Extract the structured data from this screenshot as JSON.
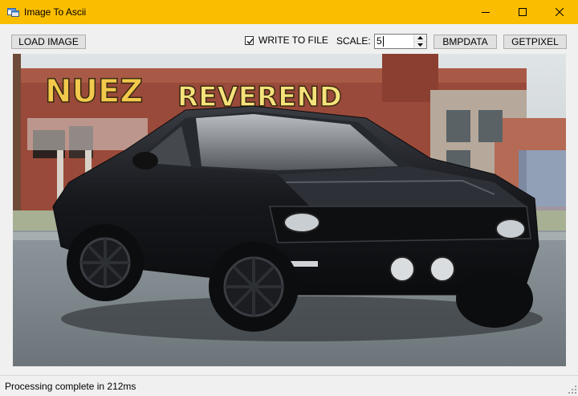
{
  "window": {
    "title": "Image To Ascii",
    "icons": {
      "app": "app-window-icon",
      "minimize": "minimize-icon",
      "maximize": "maximize-icon",
      "close": "close-icon"
    }
  },
  "toolbar": {
    "load_label": "LOAD IMAGE",
    "write_to_file_label": "WRITE TO FILE",
    "write_to_file_checked": true,
    "scale_label": "SCALE:",
    "scale_value": "5",
    "bmpdata_label": "BMPDATA",
    "getpixel_label": "GETPIXEL"
  },
  "picture": {
    "description_icon": "image-preview",
    "graffiti_left": "NUEZ",
    "graffiti_right": "REVEREND"
  },
  "status": {
    "text": "Processing complete in 212ms"
  },
  "colors": {
    "titlebar": "#fbbd00",
    "button_face": "#e1e1e1",
    "client": "#f0f0f0"
  }
}
